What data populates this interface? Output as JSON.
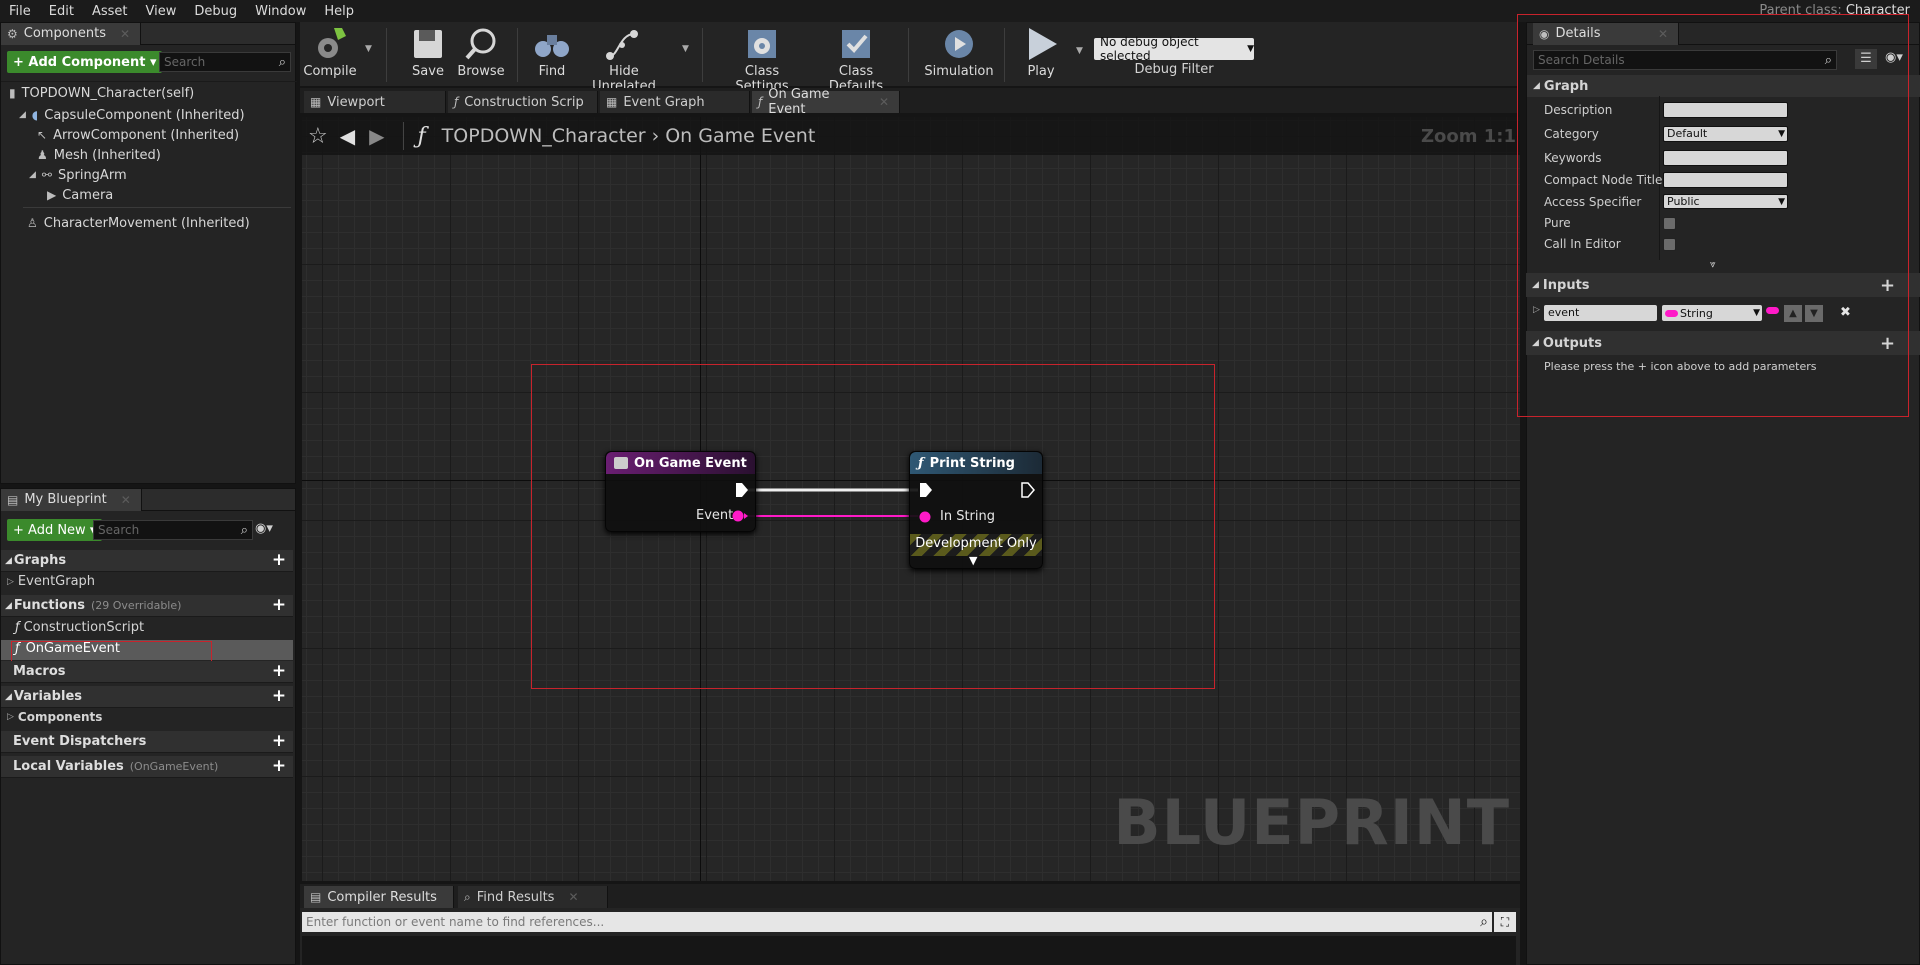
{
  "menu": [
    "File",
    "Edit",
    "Asset",
    "View",
    "Debug",
    "Window",
    "Help"
  ],
  "parent_class": {
    "label": "Parent class:",
    "value": "Character"
  },
  "components_panel": {
    "tab": "Components",
    "add_button": "+ Add Component ▾",
    "search_placeholder": "Search",
    "root": "TOPDOWN_Character(self)",
    "items": [
      "CapsuleComponent (Inherited)",
      "ArrowComponent (Inherited)",
      "Mesh (Inherited)",
      "SpringArm",
      "Camera",
      "CharacterMovement (Inherited)"
    ]
  },
  "toolbar": {
    "compile": "Compile",
    "save": "Save",
    "browse": "Browse",
    "find": "Find",
    "hide_unrelated": "Hide Unrelated",
    "class_settings": "Class Settings",
    "class_defaults": "Class Defaults",
    "simulation": "Simulation",
    "play": "Play",
    "debug_object": "No debug object selected",
    "debug_filter": "Debug Filter"
  },
  "editor_tabs": [
    "Viewport",
    "Construction Scrip",
    "Event Graph",
    "On Game Event"
  ],
  "breadcrumb": {
    "class": "TOPDOWN_Character",
    "function": "On Game Event",
    "zoom": "Zoom 1:1"
  },
  "graph": {
    "watermark": "BLUEPRINT",
    "node_event": {
      "title": "On Game Event",
      "pin": "Event"
    },
    "node_print": {
      "title": "Print String",
      "pin": "In String",
      "footer": "Development Only"
    }
  },
  "my_blueprint": {
    "tab": "My Blueprint",
    "add_button": "+ Add New ▾",
    "search_placeholder": "Search",
    "graphs": "Graphs",
    "eventgraph": "EventGraph",
    "functions": "Functions",
    "functions_sub": "(29 Overridable)",
    "func_items": [
      "ConstructionScript",
      "OnGameEvent"
    ],
    "macros": "Macros",
    "variables": "Variables",
    "components": "Components",
    "dispatchers": "Event Dispatchers",
    "locals": "Local Variables",
    "locals_sub": "(OnGameEvent)"
  },
  "bottom": {
    "tabs": [
      "Compiler Results",
      "Find Results"
    ],
    "find_placeholder": "Enter function or event name to find references..."
  },
  "details": {
    "tab": "Details",
    "search_placeholder": "Search Details",
    "graph_section": "Graph",
    "labels": [
      "Description",
      "Category",
      "Keywords",
      "Compact Node Title",
      "Access Specifier",
      "Pure",
      "Call In Editor"
    ],
    "category_value": "Default",
    "access_value": "Public",
    "inputs_section": "Inputs",
    "input_name": "event",
    "input_type": "String",
    "outputs_section": "Outputs",
    "outputs_hint": "Please press the + icon above to add parameters"
  },
  "colors": {
    "accent_green": "#3b8a2c",
    "event_header": "#6a1e72",
    "function_header": "#2f5874",
    "string_pin": "#ff1ac8",
    "highlight": "#c8232c"
  }
}
